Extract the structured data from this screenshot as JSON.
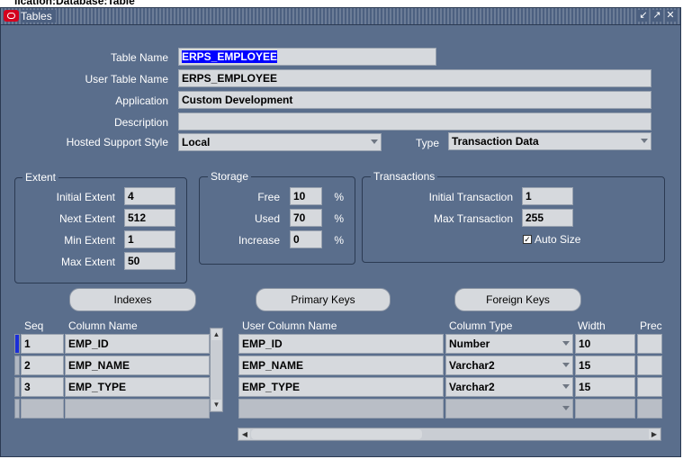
{
  "background_title": "lication:Database:Table",
  "window": {
    "title": "Tables"
  },
  "header_fields": {
    "table_name": {
      "label": "Table Name",
      "value": "ERPS_EMPLOYEE"
    },
    "user_table_name": {
      "label": "User Table Name",
      "value": "ERPS_EMPLOYEE"
    },
    "application": {
      "label": "Application",
      "value": "Custom Development"
    },
    "description": {
      "label": "Description",
      "value": ""
    },
    "hosted_support_style": {
      "label": "Hosted Support Style",
      "value": "Local"
    },
    "type": {
      "label": "Type",
      "value": "Transaction Data"
    }
  },
  "extent": {
    "title": "Extent",
    "initial": {
      "label": "Initial Extent",
      "value": "4"
    },
    "next": {
      "label": "Next Extent",
      "value": "512"
    },
    "min": {
      "label": "Min Extent",
      "value": "1"
    },
    "max": {
      "label": "Max Extent",
      "value": "50"
    }
  },
  "storage": {
    "title": "Storage",
    "free": {
      "label": "Free",
      "value": "10",
      "unit": "%"
    },
    "used": {
      "label": "Used",
      "value": "70",
      "unit": "%"
    },
    "increase": {
      "label": "Increase",
      "value": "0",
      "unit": "%"
    }
  },
  "transactions": {
    "title": "Transactions",
    "initial": {
      "label": "Initial Transaction",
      "value": "1"
    },
    "max": {
      "label": "Max Transaction",
      "value": "255"
    },
    "auto_size": {
      "label": "Auto Size",
      "checked": true
    }
  },
  "buttons": {
    "indexes": "Indexes",
    "primary_keys": "Primary Keys",
    "foreign_keys": "Foreign Keys"
  },
  "columns_table": {
    "headers": {
      "seq": "Seq",
      "column_name": "Column Name",
      "user_column_name": "User Column Name",
      "column_type": "Column Type",
      "width": "Width",
      "precision": "Prec"
    },
    "rows": [
      {
        "seq": "1",
        "column_name": "EMP_ID",
        "user_column_name": "EMP_ID",
        "column_type": "Number",
        "width": "10"
      },
      {
        "seq": "2",
        "column_name": "EMP_NAME",
        "user_column_name": "EMP_NAME",
        "column_type": "Varchar2",
        "width": "15"
      },
      {
        "seq": "3",
        "column_name": "EMP_TYPE",
        "user_column_name": "EMP_TYPE",
        "column_type": "Varchar2",
        "width": "15"
      }
    ]
  },
  "icons": {
    "window": "oracle-icon",
    "minimize": "minimize-icon",
    "maximize": "maximize-icon",
    "close": "close-icon"
  }
}
